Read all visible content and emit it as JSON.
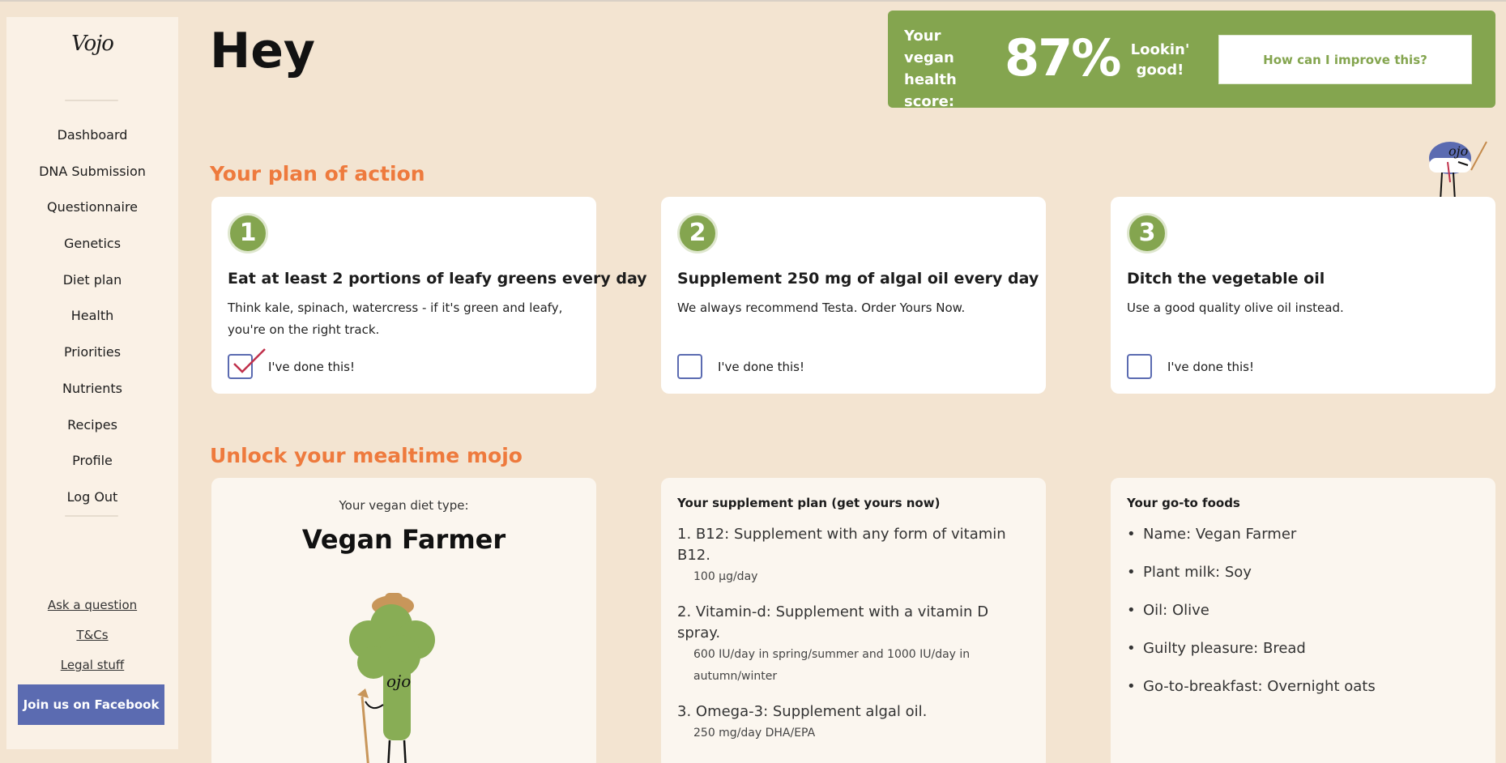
{
  "sidebar": {
    "logo": "Vojo",
    "nav": [
      "Dashboard",
      "DNA Submission",
      "Questionnaire",
      "Genetics",
      "Diet plan",
      "Health",
      "Priorities",
      "Nutrients",
      "Recipes",
      "Profile",
      "Log Out"
    ],
    "links": [
      "Ask a question",
      "T&Cs",
      "Legal stuff"
    ],
    "facebook_button": "Join us on Facebook"
  },
  "header": {
    "greeting": "Hey",
    "score_label": "Your vegan health score:",
    "score_value": "87%",
    "score_message": "Lookin' good!",
    "improve_button": "How can I improve this?"
  },
  "plan": {
    "title": "Your plan of action",
    "actions": [
      {
        "number": "1",
        "title": "Eat at least 2 portions of leafy greens every day",
        "description": "Think kale, spinach, watercress - if it's green and leafy, you're on the right track.",
        "checkbox_label": "I've done this!",
        "checked": true
      },
      {
        "number": "2",
        "title": "Supplement 250 mg of algal oil every day",
        "description": "We always recommend Testa. Order Yours Now.",
        "checkbox_label": "I've done this!",
        "checked": false
      },
      {
        "number": "3",
        "title": "Ditch the vegetable oil",
        "description": "Use a good quality olive oil instead.",
        "checkbox_label": "I've done this!",
        "checked": false
      }
    ]
  },
  "mealtime": {
    "title": "Unlock your mealtime mojo",
    "diet": {
      "kicker": "Your vegan diet type:",
      "type": "Vegan Farmer"
    },
    "supplements": {
      "heading": "Your supplement plan (get yours now)",
      "items": [
        {
          "main": "B12: Supplement with any form of vitamin B12.",
          "sub": "100 µg/day"
        },
        {
          "main": "Vitamin-d: Supplement with a vitamin D spray.",
          "sub": "600 IU/day in spring/summer and 1000 IU/day in autumn/winter"
        },
        {
          "main": "Omega-3: Supplement algal oil.",
          "sub": "250 mg/day DHA/EPA"
        }
      ]
    },
    "foods": {
      "heading": "Your go-to foods",
      "items": [
        "Name: Vegan Farmer",
        "Plant milk: Soy",
        "Oil: Olive",
        "Guilty pleasure: Bread",
        "Go-to-breakfast: Overnight oats"
      ]
    }
  },
  "colors": {
    "brand_green": "#84a54f",
    "accent_orange": "#ee7a3d",
    "facebook_blue": "#5b6bb1",
    "background": "#f3e4d1"
  }
}
